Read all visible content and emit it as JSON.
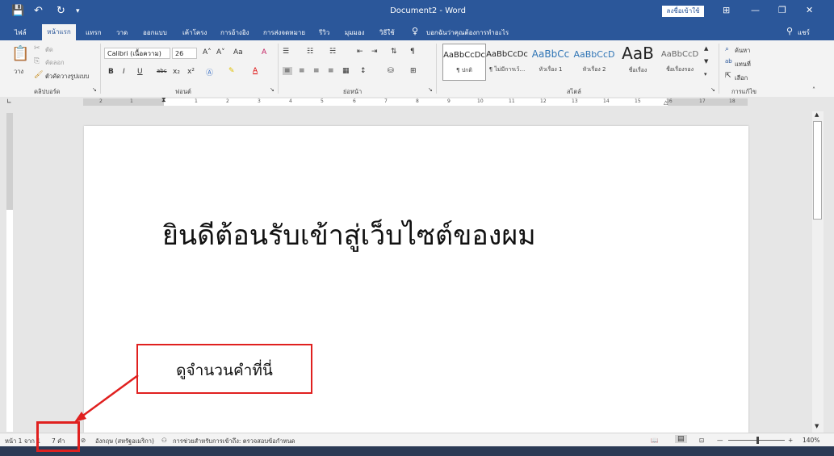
{
  "titlebar": {
    "title": "Document2 - Word",
    "signin": "ลงชื่อเข้าใช้",
    "save_icon": "💾",
    "undo_icon": "↶",
    "redo_icon": "↻",
    "customize_icon": "▾",
    "ribbon_options_icon": "⊞",
    "minimize_icon": "—",
    "restore_icon": "❐",
    "close_icon": "✕"
  },
  "tabs": {
    "file": "ไฟล์",
    "home": "หน้าแรก",
    "insert": "แทรก",
    "draw": "วาด",
    "design": "ออกแบบ",
    "layout": "เค้าโครง",
    "references": "การอ้างอิง",
    "mailings": "การส่งจดหมาย",
    "review": "รีวิว",
    "view": "มุมมอง",
    "help": "วิธีใช้",
    "tellme": "บอกฉันว่าคุณต้องการทำอะไร",
    "share": "แชร์"
  },
  "ribbon": {
    "clipboard": {
      "label": "คลิปบอร์ด",
      "paste": "วาง",
      "cut": "ตัด",
      "copy": "คัดลอก",
      "format_painter": "ตัวคัดวางรูปแบบ"
    },
    "font": {
      "label": "ฟอนต์",
      "name": "Calibri (เนื้อความ)",
      "size": "26",
      "bold": "B",
      "italic": "I",
      "underline": "U",
      "strike": "abc",
      "subscript": "x₂",
      "superscript": "x²",
      "grow": "A˄",
      "shrink": "A˅",
      "case": "Aa",
      "clear": "A"
    },
    "paragraph": {
      "label": "ย่อหน้า"
    },
    "styles": {
      "label": "สไตล์",
      "items": [
        {
          "sample": "AaBbCcDc",
          "name": "¶ ปกติ"
        },
        {
          "sample": "AaBbCcDc",
          "name": "¶ ไม่มีการเว้…"
        },
        {
          "sample": "AaBbCc",
          "name": "หัวเรื่อง 1"
        },
        {
          "sample": "AaBbCcD",
          "name": "หัวเรื่อง 2"
        },
        {
          "sample": "AaB",
          "name": "ชื่อเรื่อง"
        },
        {
          "sample": "AaBbCcD",
          "name": "ชื่อเรื่องรอง"
        }
      ]
    },
    "editing": {
      "label": "การแก้ไข",
      "find": "ค้นหา",
      "replace": "แทนที่",
      "select": "เลือก"
    }
  },
  "ruler": {
    "numbers": [
      "2",
      "1",
      "1",
      "2",
      "3",
      "4",
      "5",
      "6",
      "7",
      "8",
      "9",
      "10",
      "11",
      "12",
      "13",
      "14",
      "15",
      "16",
      "17",
      "18"
    ]
  },
  "document": {
    "text": "ยินดีต้อนรับเข้าสู่เว็บไซต์ของผม"
  },
  "statusbar": {
    "page": "หน้า 1 จาก 1",
    "words": "7 คำ",
    "language": "อังกฤษ (สหรัฐอเมริกา)",
    "accessibility": "การช่วยสำหรับการเข้าถึง: ตรวจสอบข้อกำหนด",
    "zoom": "140%"
  },
  "annotation": {
    "callout": "ดูจำนวนคำที่นี่"
  }
}
